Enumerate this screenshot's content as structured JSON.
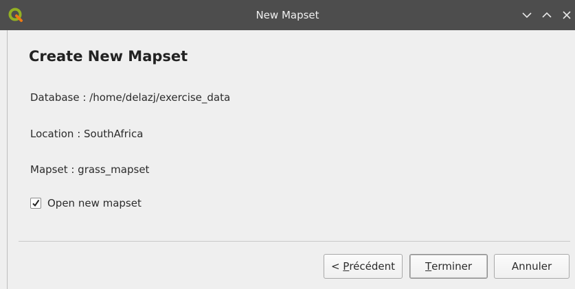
{
  "window": {
    "title": "New Mapset",
    "app_icon": "qgis-logo-icon",
    "controls": [
      "minimize-icon",
      "maximize-icon",
      "close-icon"
    ]
  },
  "page": {
    "title": "Create New Mapset",
    "database_line": "Database : /home/delazj/exercise_data",
    "location_line": "Location : SouthAfrica",
    "mapset_line": "Mapset : grass_mapset"
  },
  "options": {
    "open_new_mapset_label": "Open new mapset",
    "open_new_mapset_checked": true
  },
  "buttons": {
    "previous": {
      "prefix": "< ",
      "mnemonic": "P",
      "rest": "récédent"
    },
    "finish": {
      "mnemonic": "T",
      "rest": "erminer"
    },
    "cancel": "Annuler"
  },
  "colors": {
    "titlebar": "#4d4d4d",
    "background": "#efefef",
    "qgis_green": "#93b023"
  }
}
